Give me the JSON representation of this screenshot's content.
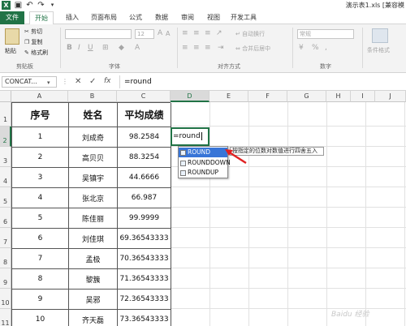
{
  "titlebar": {
    "doc_title": "演示表1.xls [兼容模"
  },
  "menu": {
    "tabs": [
      "文件",
      "开始",
      "插入",
      "页面布局",
      "公式",
      "数据",
      "审阅",
      "视图",
      "开发工具"
    ]
  },
  "ribbon": {
    "paste_label": "粘贴",
    "cut_label": "剪切",
    "copy_label": "复制",
    "format_painter_label": "格式刷",
    "font_size": "12",
    "wrap_text_label": "自动换行",
    "number_format": "常规",
    "merge_label": "合并后居中",
    "conditional_label": "条件格式",
    "groups": {
      "clipboard": "剪贴板",
      "font": "字体",
      "alignment": "对齐方式",
      "number": "数字"
    }
  },
  "formula_bar": {
    "name_box": "CONCAT...",
    "cancel": "✕",
    "enter": "✓",
    "fx": "fx",
    "input": "=round"
  },
  "sheet": {
    "columns": [
      "A",
      "B",
      "C",
      "D",
      "E",
      "F",
      "G",
      "H",
      "I",
      "J"
    ],
    "rows": [
      "1",
      "2",
      "3",
      "4",
      "5",
      "6",
      "7",
      "8",
      "9",
      "10",
      "11"
    ],
    "headers": [
      "序号",
      "姓名",
      "平均成绩"
    ],
    "data": [
      [
        "1",
        "刘成奇",
        "98.2584"
      ],
      [
        "2",
        "高贝贝",
        "88.3254"
      ],
      [
        "3",
        "吴镇宇",
        "44.6666"
      ],
      [
        "4",
        "张北京",
        "66.987"
      ],
      [
        "5",
        "陈佳丽",
        "99.9999"
      ],
      [
        "6",
        "刘佳琪",
        "69.36543333"
      ],
      [
        "7",
        "孟极",
        "70.36543333"
      ],
      [
        "8",
        "黎簇",
        "71.36543333"
      ],
      [
        "9",
        "吴邪",
        "72.36543333"
      ],
      [
        "10",
        "齐天磊",
        "73.36543333"
      ]
    ],
    "active_cell_value": "=round"
  },
  "autocomplete": {
    "items": [
      "ROUND",
      "ROUNDDOWN",
      "ROUNDUP"
    ],
    "tooltip": "按指定的位数对数值进行四舍五入"
  },
  "watermark": "Baidu 经验",
  "colors": {
    "accent": "#217346",
    "selection": "#3875d7",
    "arrow": "#e02020"
  }
}
